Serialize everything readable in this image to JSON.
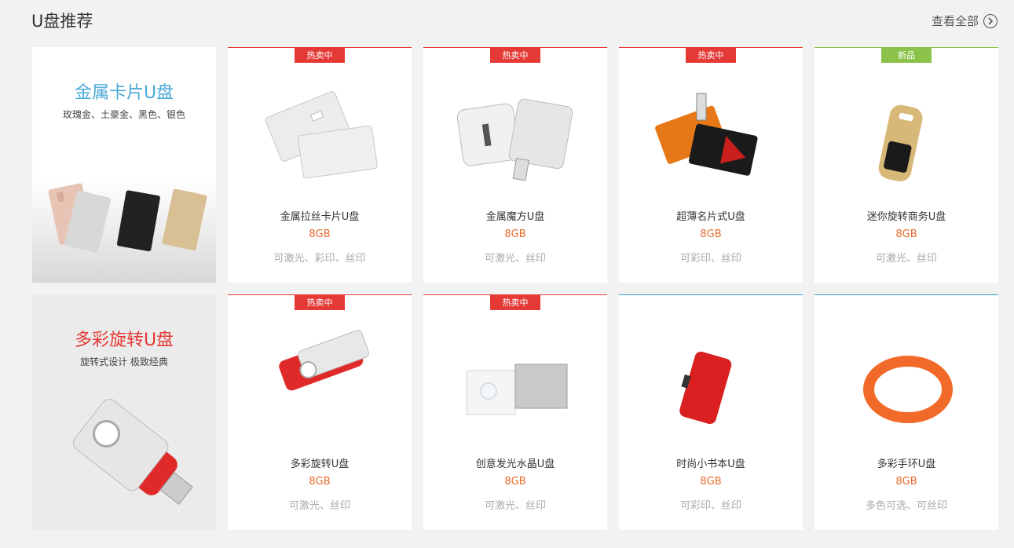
{
  "header": {
    "title": "U盘推荐",
    "view_all": "查看全部"
  },
  "features": [
    {
      "title": "金属卡片U盘",
      "subtitle": "玫瑰金、土豪金、黑色、银色",
      "title_color": "#4aa8d8"
    },
    {
      "title": "多彩旋转U盘",
      "subtitle": "旋转式设计 极致经典",
      "title_color": "#e53935"
    }
  ],
  "products": [
    {
      "badge": "热卖中",
      "name": "金属拉丝卡片U盘",
      "capacity": "8GB",
      "desc": "可激光、彩印、丝印"
    },
    {
      "badge": "热卖中",
      "name": "金属魔方U盘",
      "capacity": "8GB",
      "desc": "可激光、丝印"
    },
    {
      "badge": "热卖中",
      "name": "超薄名片式U盘",
      "capacity": "8GB",
      "desc": "可彩印、丝印"
    },
    {
      "badge": "新品",
      "name": "迷你旋转商务U盘",
      "capacity": "8GB",
      "desc": "可激光、丝印"
    },
    {
      "badge": "热卖中",
      "name": "多彩旋转U盘",
      "capacity": "8GB",
      "desc": "可激光、丝印"
    },
    {
      "badge": "热卖中",
      "name": "创意发光水晶U盘",
      "capacity": "8GB",
      "desc": "可激光、丝印"
    },
    {
      "badge": "",
      "name": "时尚小书本U盘",
      "capacity": "8GB",
      "desc": "可彩印、丝印"
    },
    {
      "badge": "",
      "name": "多彩手环U盘",
      "capacity": "8GB",
      "desc": "多色可选、可丝印"
    }
  ],
  "colors": {
    "hot_badge": "#e53935",
    "new_badge": "#8bc34a",
    "capacity": "#e8692c",
    "accent_blue": "#2f9fc7"
  }
}
